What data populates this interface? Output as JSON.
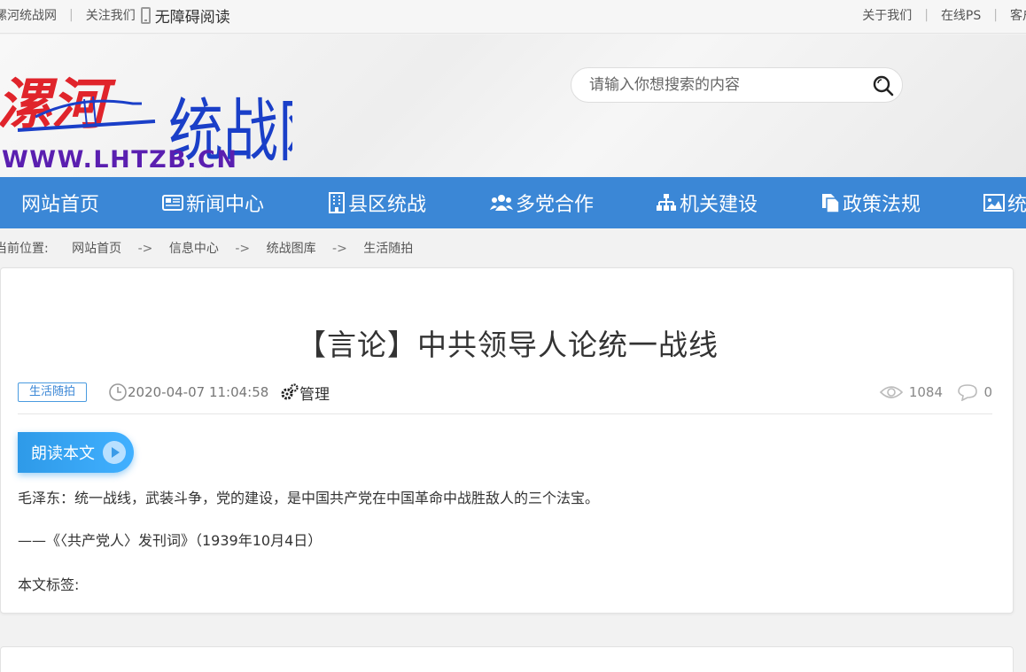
{
  "topbar": {
    "site_name": "漯河统战网",
    "follow": "关注我们",
    "accessible": "无障碍阅读",
    "about": "关于我们",
    "ps": "在线PS",
    "client": "客户"
  },
  "header": {
    "logo_chars": "漯河",
    "logo_name": "统战网",
    "logo_url": "WWW.LHTZB.CN",
    "search_placeholder": "请输入你想搜索的内容"
  },
  "nav": {
    "items": [
      {
        "label": "网站首页",
        "icon": "home"
      },
      {
        "label": "新闻中心",
        "icon": "newspaper-icon"
      },
      {
        "label": "县区统战",
        "icon": "building-icon"
      },
      {
        "label": "多党合作",
        "icon": "users-icon"
      },
      {
        "label": "机关建设",
        "icon": "sitemap-icon"
      },
      {
        "label": "政策法规",
        "icon": "files-icon"
      },
      {
        "label": "统",
        "icon": "image-icon"
      }
    ]
  },
  "breadcrumb": {
    "prefix": "当前位置:",
    "items": [
      "网站首页",
      "信息中心",
      "统战图库",
      "生活随拍"
    ],
    "arrow": "->"
  },
  "article": {
    "title": "【言论】中共领导人论统一战线",
    "category": "生活随拍",
    "datetime": "2020-04-07 11:04:58",
    "manage": "管理",
    "views": "1084",
    "comments": "0",
    "read_button": "朗读本文",
    "paragraphs": [
      "毛泽东：统一战线，武装斗争，党的建设，是中国共产党在中国革命中战胜敌人的三个法宝。",
      "——《〈共产党人〉发刊词》（1939年10月4日）",
      "本文标签:"
    ]
  },
  "colors": {
    "nav_bg": "#3b87d6",
    "accent": "#2e9ae8",
    "logo_red": "#e0242b",
    "logo_blue": "#1a3fc8",
    "logo_purple": "#5a1fb0"
  }
}
